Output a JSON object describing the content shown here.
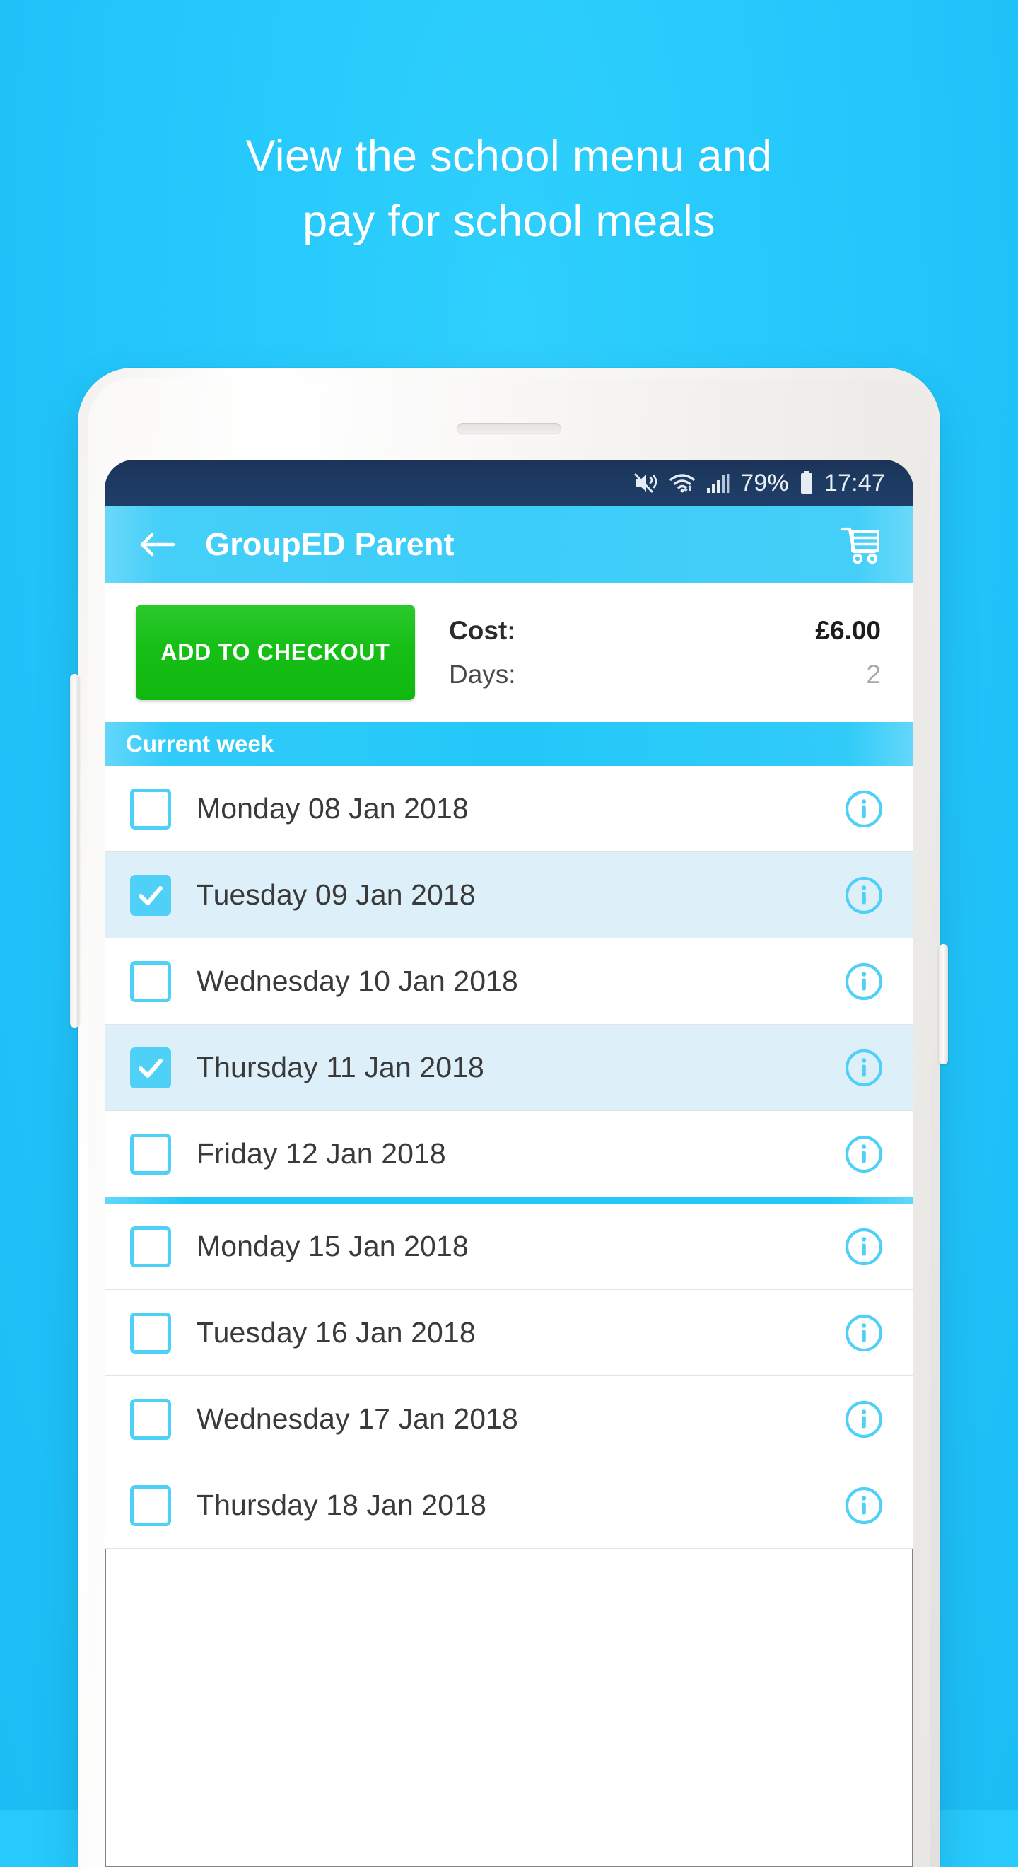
{
  "promo": {
    "headline_line1": "View the school menu and",
    "headline_line2": "pay for school meals",
    "background_color": "#26cafc",
    "text_color": "#ffffff"
  },
  "status_bar": {
    "battery_percent": "79%",
    "time": "17:47",
    "icons": [
      "mute-vibrate-icon",
      "wifi-icon",
      "signal-icon",
      "battery-icon"
    ],
    "background_color": "#1d3a61"
  },
  "app_bar": {
    "title": "GroupED Parent",
    "back_icon": "arrow-left-icon",
    "cart_icon": "shopping-cart-icon",
    "background_color": "#45cff8"
  },
  "summary": {
    "checkout_button_label": "ADD TO CHECKOUT",
    "checkout_button_color": "#16bf16",
    "cost_label": "Cost:",
    "cost_value": "£6.00",
    "days_label": "Days:",
    "days_value": "2"
  },
  "section": {
    "current_week_label": "Current week",
    "background_color": "#23c8f8"
  },
  "days": [
    {
      "label": "Monday 08 Jan 2018",
      "checked": false,
      "info_icon": "info-icon"
    },
    {
      "label": "Tuesday 09 Jan 2018",
      "checked": true,
      "info_icon": "info-icon"
    },
    {
      "label": "Wednesday 10 Jan 2018",
      "checked": false,
      "info_icon": "info-icon"
    },
    {
      "label": "Thursday 11 Jan 2018",
      "checked": true,
      "info_icon": "info-icon"
    },
    {
      "label": "Friday 12 Jan 2018",
      "checked": false,
      "info_icon": "info-icon"
    },
    {
      "label": "Monday 15 Jan 2018",
      "checked": false,
      "info_icon": "info-icon"
    },
    {
      "label": "Tuesday 16 Jan 2018",
      "checked": false,
      "info_icon": "info-icon"
    },
    {
      "label": "Wednesday 17 Jan 2018",
      "checked": false,
      "info_icon": "info-icon"
    },
    {
      "label": "Thursday 18 Jan 2018",
      "checked": false,
      "info_icon": "info-icon"
    }
  ],
  "week_divider_after_index": 4,
  "accent_color": "#4fd0f7"
}
